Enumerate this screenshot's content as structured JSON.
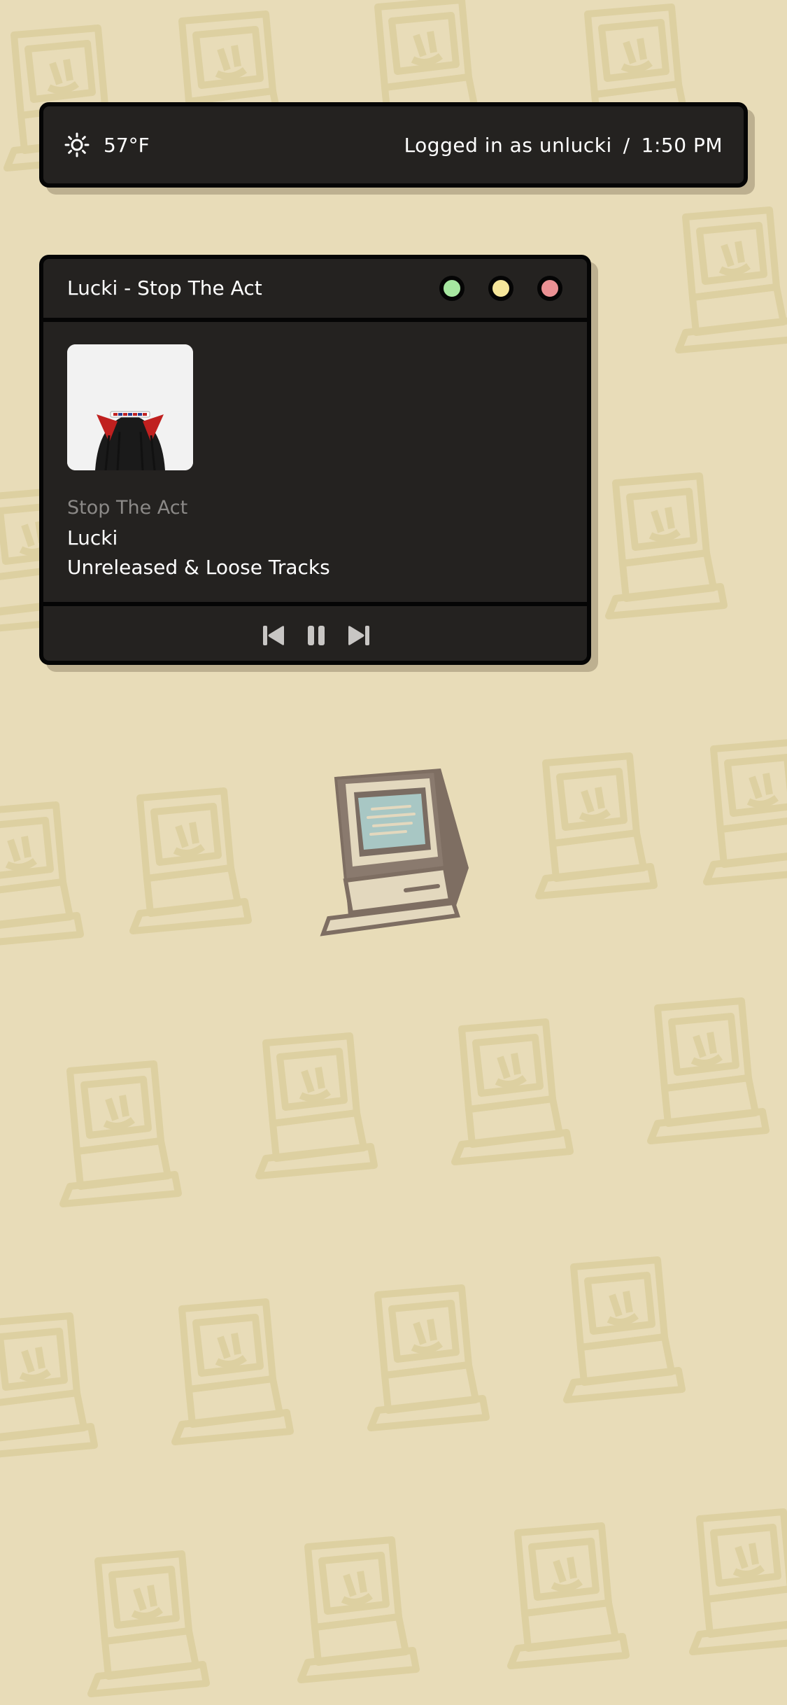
{
  "status_bar": {
    "weather_icon": "sun-icon",
    "temperature": "57°F",
    "login_text": "Logged in as unlucki",
    "separator": "/",
    "time": "1:50 PM"
  },
  "player": {
    "window_title": "Lucki - Stop The Act",
    "window_buttons": [
      {
        "name": "green",
        "color": "#a6e7a0"
      },
      {
        "name": "yellow",
        "color": "#f6e69a"
      },
      {
        "name": "red",
        "color": "#ea9093"
      }
    ],
    "track": "Stop The Act",
    "artist": "Lucki",
    "album": "Unreleased & Loose Tracks",
    "controls": [
      "previous-icon",
      "pause-icon",
      "next-icon"
    ]
  },
  "colors": {
    "background": "#e8dcb8",
    "panel": "#242220",
    "border": "#050505"
  }
}
